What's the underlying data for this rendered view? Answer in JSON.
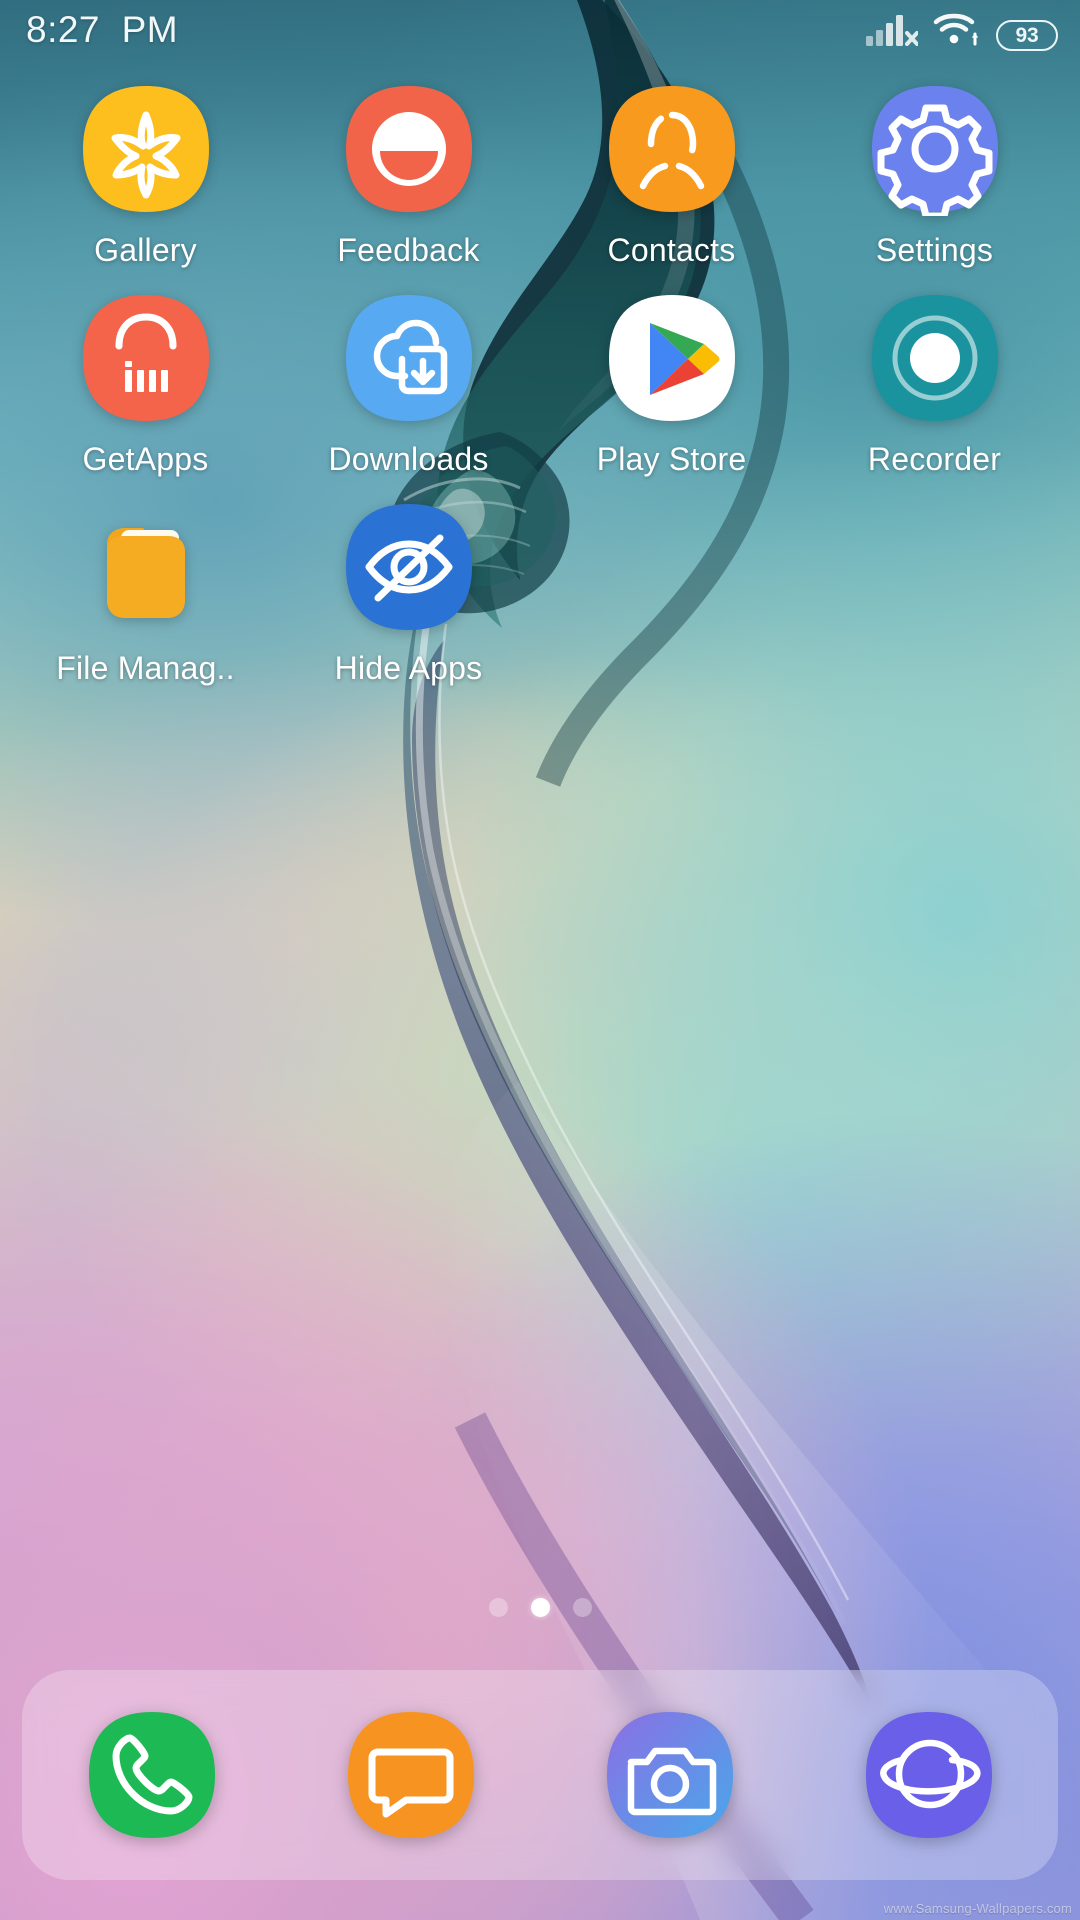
{
  "status_bar": {
    "time": "8:27  PM",
    "signal": {
      "icon": "cellular-signal-no-sim-icon",
      "label": "no SIM"
    },
    "wifi": {
      "icon": "wifi-icon",
      "label": "Wi-Fi connected"
    },
    "battery": {
      "icon": "battery-icon",
      "level": "93"
    }
  },
  "home": {
    "apps": [
      {
        "label": "Gallery",
        "icon": "gallery-icon",
        "bg": "#fcbf1e"
      },
      {
        "label": "Feedback",
        "icon": "feedback-icon",
        "bg": "#f2644a"
      },
      {
        "label": "Contacts",
        "icon": "contacts-icon",
        "bg": "#f79a1e"
      },
      {
        "label": "Settings",
        "icon": "settings-gear-icon",
        "bg": "#6b82ee"
      },
      {
        "label": "GetApps",
        "icon": "getapps-mi-icon",
        "bg": "#f4644a"
      },
      {
        "label": "Downloads",
        "icon": "downloads-icon",
        "bg": "#57a9f2"
      },
      {
        "label": "Play Store",
        "icon": "play-store-icon",
        "bg": "#ffffff"
      },
      {
        "label": "Recorder",
        "icon": "recorder-icon",
        "bg": "#1a939e"
      },
      {
        "label": "File Manag..",
        "icon": "file-manager-icon",
        "bg": "#f2a61e"
      },
      {
        "label": "Hide Apps",
        "icon": "hide-apps-eye-icon",
        "bg": "#2a73d4"
      }
    ],
    "page_indicator": {
      "total": 3,
      "active_index": 1
    }
  },
  "dock": {
    "apps": [
      {
        "label": "Phone",
        "icon": "phone-icon",
        "bg": "#1db954"
      },
      {
        "label": "Messages",
        "icon": "messages-icon",
        "bg": "#f79421"
      },
      {
        "label": "Camera",
        "icon": "camera-icon",
        "bg": "#7a6fe0"
      },
      {
        "label": "Browser",
        "icon": "browser-planet-icon",
        "bg": "#6a5fe8"
      }
    ]
  },
  "wallpaper": {
    "watermark": "www.Samsung-Wallpapers.com"
  }
}
